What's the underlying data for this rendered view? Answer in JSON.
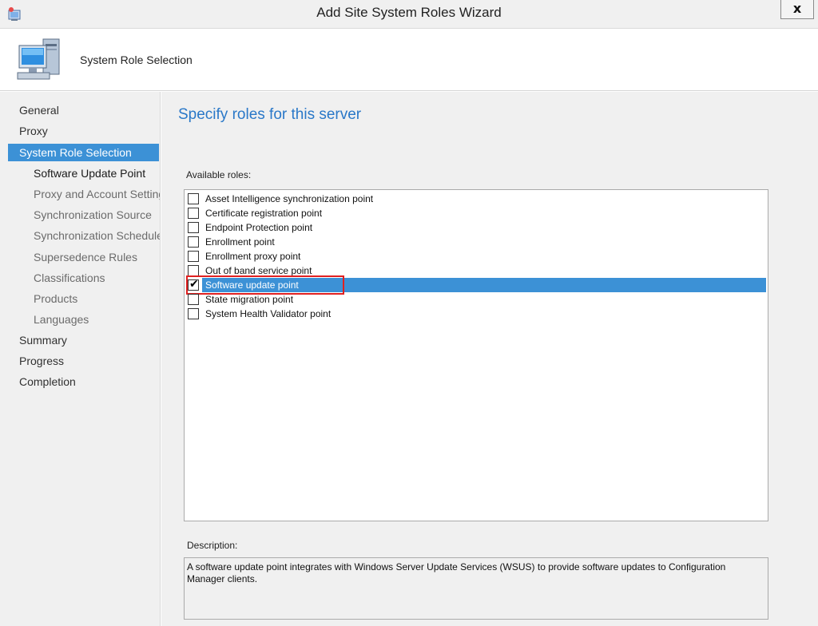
{
  "window": {
    "title": "Add Site System Roles Wizard",
    "close_label": "x"
  },
  "header": {
    "step_title": "System Role Selection"
  },
  "nav": {
    "items": [
      {
        "label": "General",
        "level": 0,
        "state": "normal"
      },
      {
        "label": "Proxy",
        "level": 0,
        "state": "normal"
      },
      {
        "label": "System Role Selection",
        "level": 0,
        "state": "active"
      },
      {
        "label": "Software Update Point",
        "level": 1,
        "state": "current"
      },
      {
        "label": "Proxy and Account Settings",
        "level": 1,
        "state": "normal"
      },
      {
        "label": "Synchronization Source",
        "level": 1,
        "state": "normal"
      },
      {
        "label": "Synchronization Schedule",
        "level": 1,
        "state": "normal"
      },
      {
        "label": "Supersedence Rules",
        "level": 1,
        "state": "normal"
      },
      {
        "label": "Classifications",
        "level": 1,
        "state": "normal"
      },
      {
        "label": "Products",
        "level": 1,
        "state": "normal"
      },
      {
        "label": "Languages",
        "level": 1,
        "state": "normal"
      },
      {
        "label": "Summary",
        "level": 0,
        "state": "normal"
      },
      {
        "label": "Progress",
        "level": 0,
        "state": "normal"
      },
      {
        "label": "Completion",
        "level": 0,
        "state": "normal"
      }
    ]
  },
  "main": {
    "heading": "Specify roles for this server",
    "roles_label": "Available roles:",
    "roles": [
      {
        "label": "Asset Intelligence synchronization point",
        "checked": false,
        "selected": false
      },
      {
        "label": "Certificate registration point",
        "checked": false,
        "selected": false
      },
      {
        "label": "Endpoint Protection point",
        "checked": false,
        "selected": false
      },
      {
        "label": "Enrollment point",
        "checked": false,
        "selected": false
      },
      {
        "label": "Enrollment proxy point",
        "checked": false,
        "selected": false
      },
      {
        "label": "Out of band service point",
        "checked": false,
        "selected": false
      },
      {
        "label": "Software update point",
        "checked": true,
        "selected": true
      },
      {
        "label": "State migration point",
        "checked": false,
        "selected": false
      },
      {
        "label": "System Health Validator point",
        "checked": false,
        "selected": false
      }
    ],
    "description_label": "Description:",
    "description_text": "A software update point integrates with Windows Server Update Services (WSUS) to provide software updates to Configuration Manager clients."
  },
  "colors": {
    "accent": "#3c91d6",
    "heading": "#2a78c8",
    "highlight": "#e02020"
  }
}
